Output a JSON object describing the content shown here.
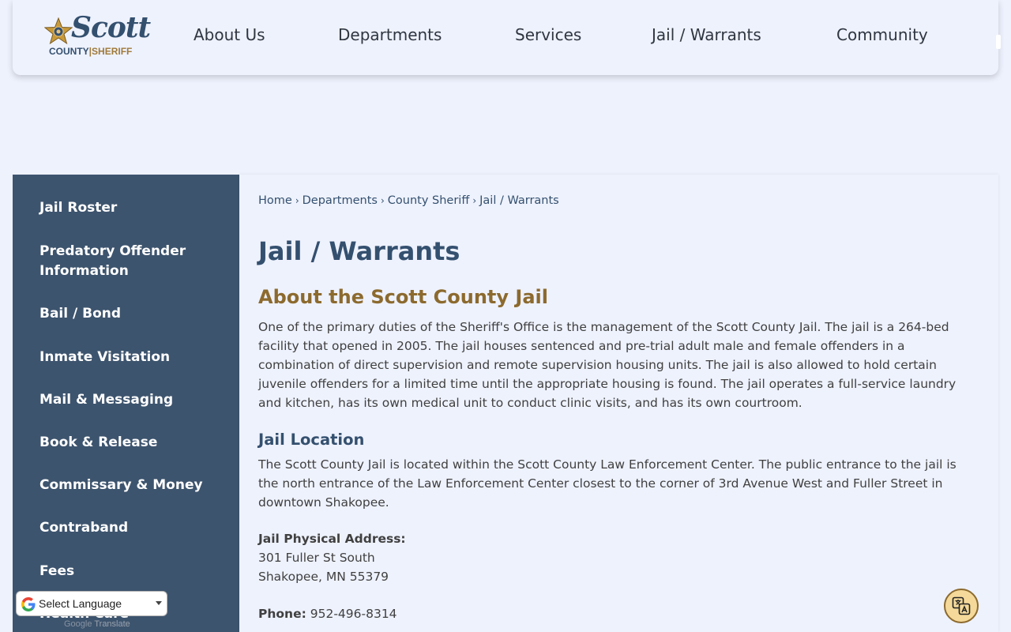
{
  "header": {
    "logo": {
      "word": "Scott",
      "county": "COUNTY",
      "divider": "|",
      "sheriff": "SHERIFF"
    },
    "nav": [
      "About Us",
      "Departments",
      "Services",
      "Jail / Warrants",
      "Community"
    ]
  },
  "sidebar": {
    "items": [
      "Jail Roster",
      "Predatory Offender Information",
      "Bail / Bond",
      "Inmate Visitation",
      "Mail & Messaging",
      "Book & Release",
      "Commissary & Money",
      "Contraband",
      "Fees",
      "Health Care"
    ]
  },
  "breadcrumb": [
    "Home",
    "Departments",
    "County Sheriff",
    "Jail / Warrants"
  ],
  "breadcrumb_sep": "›",
  "page_title": "Jail / Warrants",
  "about": {
    "heading": "About the Scott County Jail",
    "body": "One of the primary duties of the Sheriff's Office is the management of the Scott County Jail. The jail is a 264-bed facility that opened in 2005. The jail houses sentenced and pre-trial adult male and female offenders in a combination of direct supervision and remote supervision housing units. The jail is also allowed to hold certain juvenile offenders for a limited time until the appropriate housing is found. The jail operates a full-service laundry and kitchen, has its own medical unit to conduct clinic visits, and has its own courtroom."
  },
  "location": {
    "heading": "Jail Location",
    "body": "The Scott County Jail is located within the Scott County Law Enforcement Center. The public entrance to the jail is the north entrance of the Law Enforcement Center closest to the corner of 3rd Avenue West and Fuller Street in downtown Shakopee.",
    "address_label": "Jail Physical Address:",
    "address_line1": "301 Fuller St South",
    "address_line2": "Shakopee, MN 55379",
    "phone_label": "Phone:",
    "phone": "952-496-8314"
  },
  "translate": {
    "select_label": "Select Language",
    "powered_by": "Google",
    "powered_suffix": "Translate"
  },
  "icons": {
    "logo_star": "sheriff-star-icon",
    "translate": "google-g-icon",
    "accessibility": "translate-accessibility-icon"
  },
  "colors": {
    "primary": "#34506f",
    "sidebar_bg": "#3d546e",
    "accent_gold": "#8c6a2e",
    "page_bg": "#eef2fd"
  }
}
